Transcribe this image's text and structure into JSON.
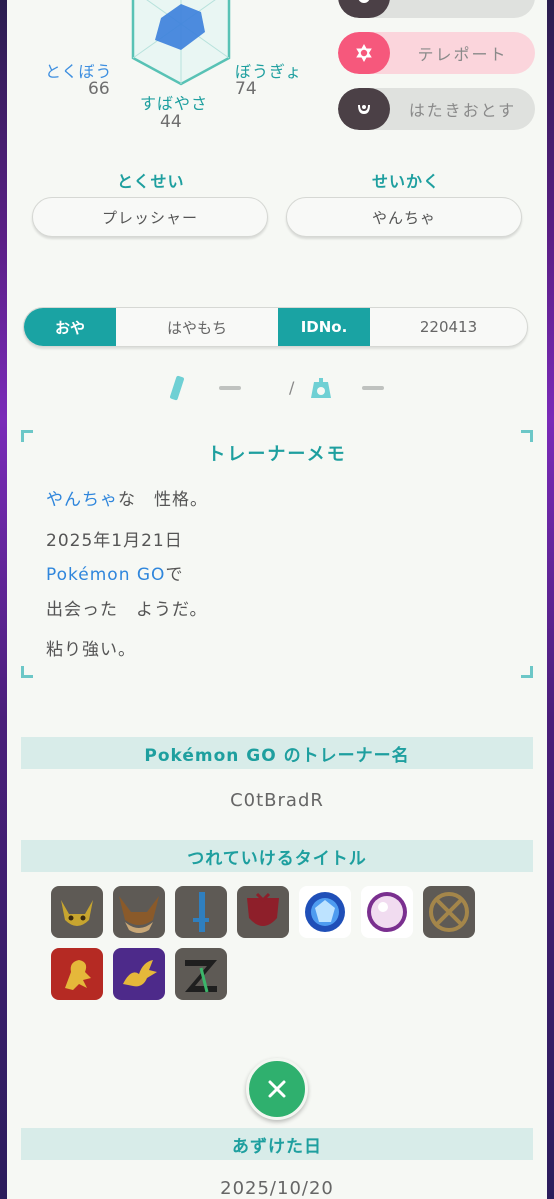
{
  "stats": {
    "sp_atk_label": "とくぼう",
    "sp_atk_value": "66",
    "sp_def_label": "ぼうぎょ",
    "sp_def_value": "74",
    "speed_label": "すばやさ",
    "speed_value": "44"
  },
  "moves": [
    {
      "name": "テレポート",
      "type_icon": "psychic-icon"
    },
    {
      "name": "はたきおとす",
      "type_icon": "dark-icon"
    }
  ],
  "ability": {
    "title": "とくせい",
    "value": "プレッシャー"
  },
  "nature": {
    "title": "せいかく",
    "value": "やんちゃ"
  },
  "ot": {
    "ot_tag": "おや",
    "ot_name": "はやもち",
    "id_tag": "IDNo.",
    "id_value": "220413"
  },
  "measure": {
    "height_icon": "ruler-icon",
    "height_value": "—",
    "separator": "/",
    "weight_icon": "scale-icon",
    "weight_value": "—"
  },
  "memo": {
    "title": "トレーナーメモ",
    "nature_word": "やんちゃ",
    "nature_suffix": "な　性格。",
    "date": "2025年1月21日",
    "place": "Pokémon GO",
    "place_suffix": "で",
    "met_text": "出会った　ようだ。",
    "characteristic": "粘り強い。"
  },
  "go_trainer": {
    "title": "Pokémon GO のトレーナー名",
    "name": "C0tBradR"
  },
  "titles": {
    "title": "つれていけるタイトル",
    "badges": [
      "pikachu-badge",
      "eevee-badge",
      "sword-badge",
      "shield-badge",
      "diamond-badge",
      "pearl-badge",
      "origin-badge",
      "gold-lion-badge",
      "purple-dragon-badge",
      "zygarde-badge"
    ]
  },
  "deposit": {
    "title": "あずけた日",
    "date": "2025/10/20"
  },
  "colors": {
    "accent": "#1aa3a3",
    "blue_text": "#2f86dc",
    "close_button": "#2fb06e",
    "psychic": "#f6587c",
    "dark": "#4b4046"
  }
}
